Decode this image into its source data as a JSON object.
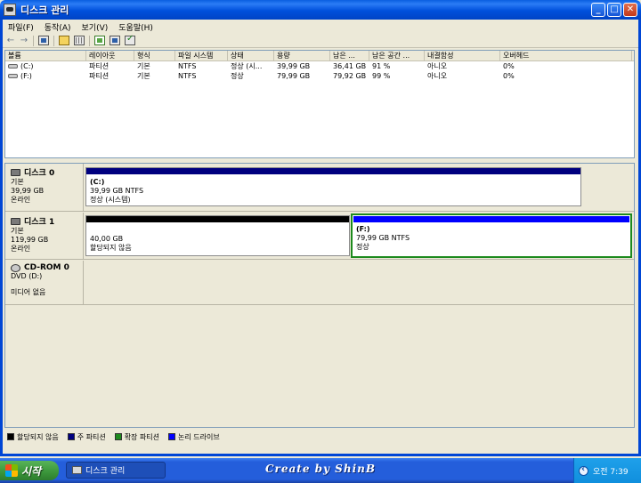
{
  "window": {
    "title": "디스크 관리",
    "minimize": "_",
    "maximize": "□",
    "close": "✕"
  },
  "menu": [
    "파일(F)",
    "동작(A)",
    "보기(V)",
    "도움말(H)"
  ],
  "toolbar": {
    "back": "←",
    "forward": "→"
  },
  "volume_list": {
    "columns": [
      "볼륨",
      "레이아웃",
      "형식",
      "파일 시스템",
      "상태",
      "용량",
      "남은 ...",
      "남은 공간 ...",
      "내결함성",
      "오버헤드"
    ],
    "rows": [
      [
        "(C:)",
        "파티션",
        "기본",
        "NTFS",
        "정상 (시...",
        "39,99 GB",
        "36,41 GB",
        "91 %",
        "아니오",
        "0%"
      ],
      [
        "(F:)",
        "파티션",
        "기본",
        "NTFS",
        "정상",
        "79,99 GB",
        "79,92 GB",
        "99 %",
        "아니오",
        "0%"
      ]
    ]
  },
  "disks": {
    "disk0": {
      "name": "디스크 0",
      "type": "기본",
      "size": "39,99 GB",
      "status": "온라인",
      "partition_c": {
        "label": "(C:)",
        "size": "39,99 GB NTFS",
        "status": "정상 (시스템)",
        "bar_color": "#00007f"
      }
    },
    "disk1": {
      "name": "디스크 1",
      "type": "기본",
      "size": "119,99 GB",
      "status": "온라인",
      "unallocated": {
        "size": "40,00 GB",
        "status": "할당되지 않음",
        "bar_color": "#000000"
      },
      "partition_f": {
        "label": "(F:)",
        "size": "79,99 GB NTFS",
        "status": "정상",
        "bar_color": "#0000ff"
      }
    },
    "cdrom0": {
      "name": "CD-ROM 0",
      "drive": "DVD (D:)",
      "status": "미디어 없음"
    }
  },
  "legend": [
    {
      "label": "할당되지 않음",
      "color": "#000000"
    },
    {
      "label": "주 파티션",
      "color": "#00007f"
    },
    {
      "label": "확장 파티션",
      "color": "#1d8a1d"
    },
    {
      "label": "논리 드라이브",
      "color": "#0000ff"
    }
  ],
  "taskbar": {
    "start_label": "시작",
    "task_label": "디스크 관리",
    "watermark": "Create by ShinB",
    "clock": "오전 7:39"
  }
}
